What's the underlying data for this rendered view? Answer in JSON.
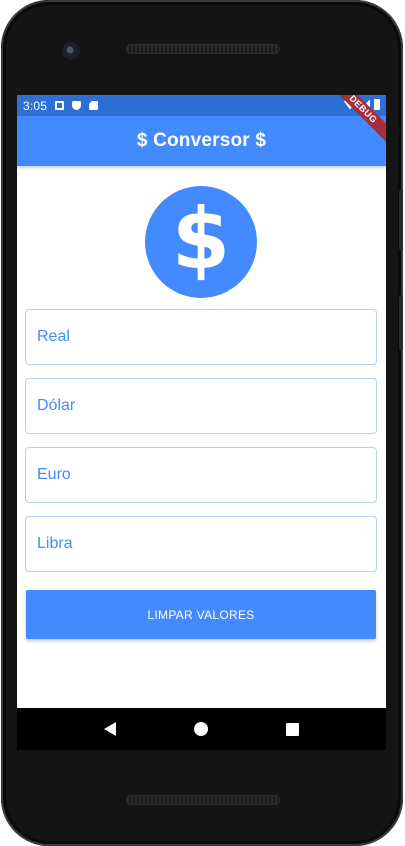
{
  "status_bar": {
    "time": "3:05",
    "icons": [
      "notification-a-icon",
      "shield-icon",
      "sd-card-icon"
    ],
    "right_icons": [
      "wifi-icon",
      "signal-icon",
      "battery-icon"
    ]
  },
  "debug_banner": "DEBUG",
  "app_bar": {
    "title": "$ Conversor $"
  },
  "logo": {
    "icon": "dollar-icon",
    "glyph": "$"
  },
  "fields": [
    {
      "placeholder": "Real",
      "value": ""
    },
    {
      "placeholder": "Dólar",
      "value": ""
    },
    {
      "placeholder": "Euro",
      "value": ""
    },
    {
      "placeholder": "Libra",
      "value": ""
    }
  ],
  "clear_button": {
    "label": "LIMPAR VALORES"
  },
  "colors": {
    "primary": "#448aff",
    "status_bar": "#2e6fd6",
    "field_border": "#b9d0f5",
    "debug_ribbon": "#a3303b"
  }
}
